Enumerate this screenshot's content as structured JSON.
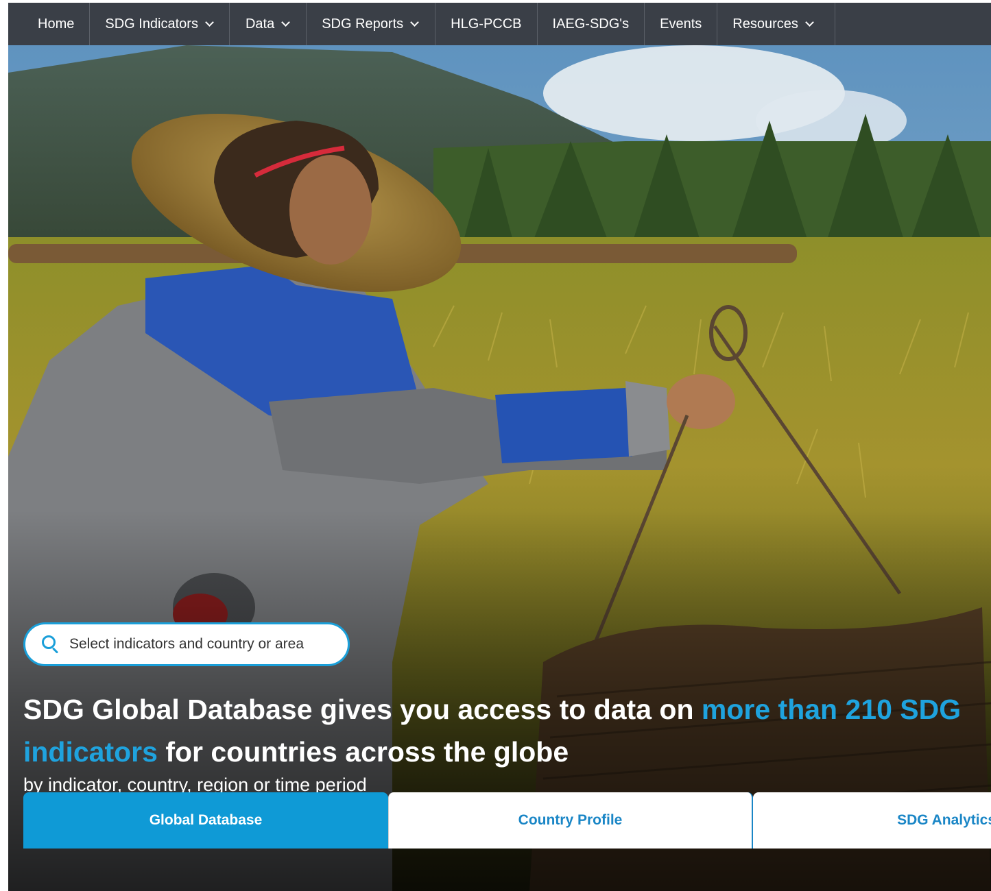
{
  "nav": {
    "items": [
      {
        "label": "Home",
        "dropdown": false
      },
      {
        "label": "SDG Indicators",
        "dropdown": true
      },
      {
        "label": "Data",
        "dropdown": true
      },
      {
        "label": "SDG Reports",
        "dropdown": true
      },
      {
        "label": "HLG-PCCB",
        "dropdown": false
      },
      {
        "label": "IAEG-SDG's",
        "dropdown": false
      },
      {
        "label": "Events",
        "dropdown": false
      },
      {
        "label": "Resources",
        "dropdown": true
      }
    ]
  },
  "hero": {
    "image": "farmer-with-shoulder-pole-in-rice-field",
    "search": {
      "placeholder": "Select indicators and country or area",
      "icon": "search-icon"
    },
    "headline": {
      "part1": "SDG Global Database gives you access to data on ",
      "highlight": "more than 210 SDG indicators",
      "part2": " for countries across the globe"
    },
    "subhead": "by indicator, country, region or time period",
    "carousel": {
      "slides": 3,
      "active": 1
    }
  },
  "tabs": [
    {
      "label": "Global Database",
      "active": true
    },
    {
      "label": "Country Profile",
      "active": false
    },
    {
      "label": "SDG Analytics",
      "active": false
    }
  ],
  "colors": {
    "nav_bg": "#3a3f47",
    "accent": "#1fa3de",
    "tab_active": "#0f9ad6",
    "tab_text": "#1a86c6"
  }
}
